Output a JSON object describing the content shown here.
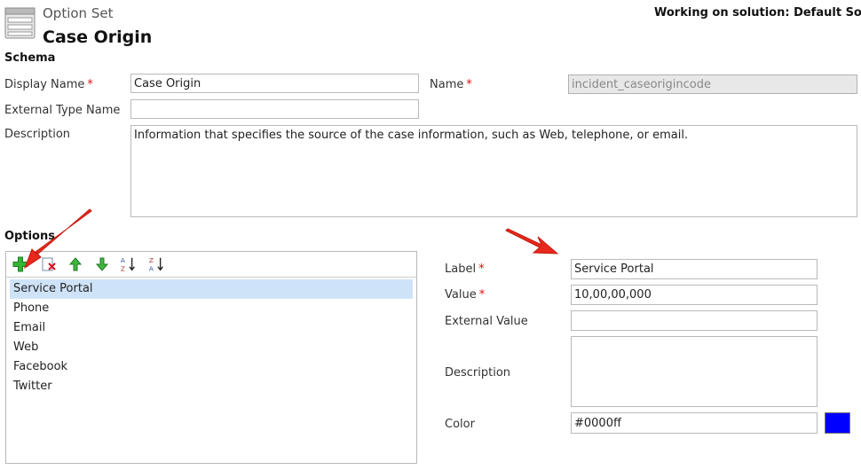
{
  "header": {
    "type_label": "Option Set",
    "title": "Case Origin",
    "solution_text": "Working on solution: Default Solution"
  },
  "schema": {
    "section_title": "Schema",
    "display_name": {
      "label": "Display Name",
      "value": "Case Origin"
    },
    "name": {
      "label": "Name",
      "value": "incident_caseorigincode"
    },
    "external_type_name": {
      "label": "External Type Name",
      "value": ""
    },
    "description": {
      "label": "Description",
      "value": "Information that specifies the source of the case information, such as Web, telephone, or email."
    },
    "required_marker": "*"
  },
  "options": {
    "section_title": "Options",
    "toolbar": [
      "add-icon",
      "delete-icon",
      "move-up-icon",
      "move-down-icon",
      "sort-ascending-icon",
      "sort-descending-icon"
    ],
    "items": [
      "Service Portal",
      "Phone",
      "Email",
      "Web",
      "Facebook",
      "Twitter"
    ],
    "selected_index": 0
  },
  "detail": {
    "label": {
      "label": "Label",
      "value": "Service Portal"
    },
    "value": {
      "label": "Value",
      "value": "10,00,00,000"
    },
    "external_value": {
      "label": "External Value",
      "value": ""
    },
    "description": {
      "label": "Description",
      "value": ""
    },
    "color": {
      "label": "Color",
      "value": "#0000ff",
      "swatch": "#0000ff"
    }
  },
  "colors": {
    "annotation_arrow": "#e8281c",
    "selection": "#cfe3f8"
  }
}
